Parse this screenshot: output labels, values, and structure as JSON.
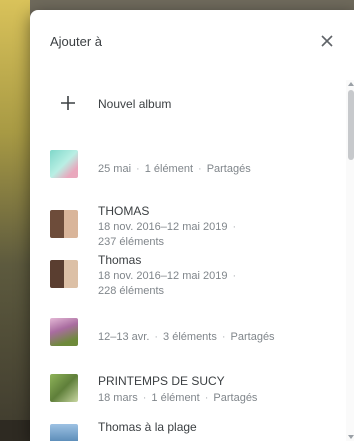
{
  "dialog": {
    "title": "Ajouter à",
    "close_icon": "close-icon"
  },
  "new_album": {
    "icon": "plus-icon",
    "label": "Nouvel album"
  },
  "albums": [
    {
      "title": "",
      "line1": [
        "25 mai",
        "1 élément",
        "Partagés"
      ],
      "line2": ""
    },
    {
      "title": "THOMAS",
      "line1": [
        "18 nov. 2016–12 mai 2019",
        ""
      ],
      "line2": "237 éléments"
    },
    {
      "title": "Thomas",
      "line1": [
        "18 nov. 2016–12 mai 2019",
        ""
      ],
      "line2": "228 éléments"
    },
    {
      "title": "",
      "line1": [
        "12–13 avr.",
        "3 éléments",
        "Partagés"
      ],
      "line2": ""
    },
    {
      "title": "PRINTEMPS DE SUCY",
      "line1": [
        "18 mars",
        "1 élément",
        "Partagés"
      ],
      "line2": ""
    },
    {
      "title": "Thomas à la plage",
      "line1": [],
      "line2": ""
    }
  ],
  "colors": {
    "text_primary": "#3c4043",
    "text_secondary": "#80868b",
    "dialog_bg": "#ffffff"
  }
}
